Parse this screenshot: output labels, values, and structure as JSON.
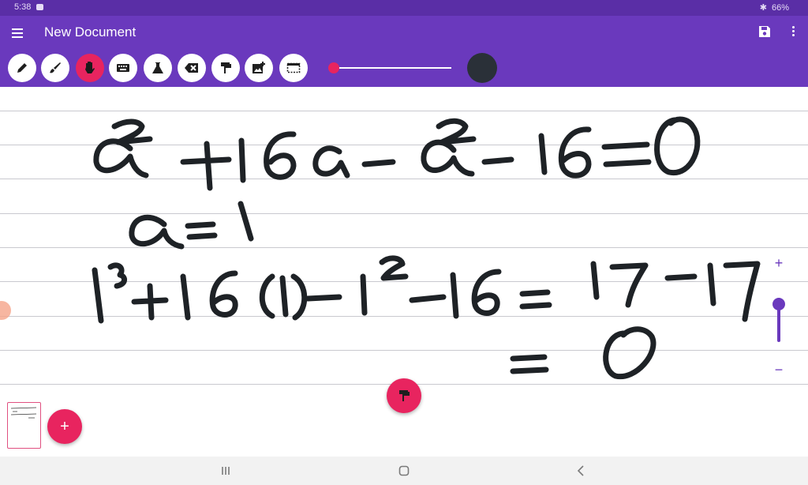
{
  "status": {
    "time": "5:38",
    "battery": "66%"
  },
  "appbar": {
    "title": "New Document"
  },
  "toolbar": {
    "tools": [
      {
        "name": "pen-tool",
        "icon": "pencil-icon",
        "active": false
      },
      {
        "name": "brush-tool",
        "icon": "brush-icon",
        "active": false
      },
      {
        "name": "hand-tool",
        "icon": "hand-icon",
        "active": true
      },
      {
        "name": "keyboard-tool",
        "icon": "keyboard-icon",
        "active": false
      },
      {
        "name": "flask-tool",
        "icon": "flask-icon",
        "active": false
      },
      {
        "name": "eraser-tool",
        "icon": "eraser-icon",
        "active": false
      },
      {
        "name": "format-paint-tool",
        "icon": "paint-roller-icon",
        "active": false
      },
      {
        "name": "add-image-tool",
        "icon": "image-plus-icon",
        "active": false
      },
      {
        "name": "select-tool",
        "icon": "selection-icon",
        "active": false
      }
    ],
    "stroke_size_fraction": 0.02,
    "current_color": "#2a3038"
  },
  "canvas": {
    "line1": "a² + 16a − a² − 16 = 0",
    "line2": "a = 1",
    "line3": "1³ + 16(1) − 1² − 16 = 17 − 17",
    "line4": "= 0",
    "ink_color": "#1e2226"
  },
  "zoom": {
    "plus": "+",
    "minus": "−",
    "level_fraction": 0.0
  },
  "fab": {
    "add": "+"
  },
  "colors": {
    "accent": "#6a39bd",
    "pink": "#e8245f"
  }
}
